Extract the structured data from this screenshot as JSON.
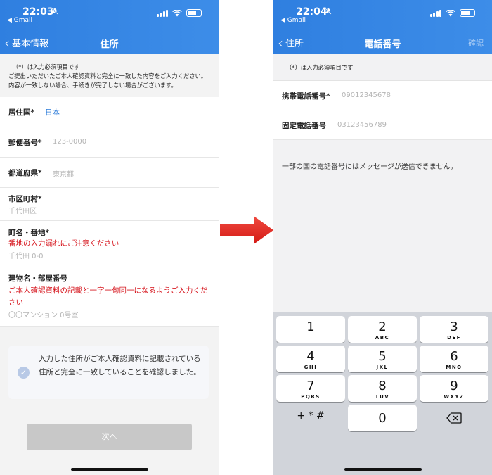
{
  "left": {
    "status": {
      "time": "22:03",
      "back_app": "◀ Gmail"
    },
    "nav": {
      "back_label": "基本情報",
      "title": "住所"
    },
    "notice": {
      "line1": "（*）は入力必須項目です",
      "line2": "ご提出いただいたご本人確認資料と完全に一致した内容をご入力ください。内容が一致しない場合、手続きが完了しない場合がございます。"
    },
    "fields": {
      "country": {
        "label": "居住国*",
        "value": "日本"
      },
      "postal": {
        "label": "郵便番号*",
        "placeholder": "123-0000"
      },
      "prefecture": {
        "label": "都道府県*",
        "placeholder": "東京都"
      },
      "city": {
        "label": "市区町村*",
        "placeholder": "千代田区"
      },
      "street": {
        "label": "町名・番地*",
        "warning": "番地の入力漏れにご注意ください",
        "placeholder": "千代田 0-0"
      },
      "building": {
        "label": "建物名・部屋番号",
        "warning": "ご本人確認資料の記載と一字一句同一になるようご入力ください",
        "placeholder": "〇〇マンション 0号室"
      }
    },
    "confirm_text": "入力した住所がご本人確認資料に記載されている住所と完全に一致していることを確認しました。",
    "next_button": "次へ"
  },
  "right": {
    "status": {
      "time": "22:04",
      "back_app": "◀ Gmail"
    },
    "nav": {
      "back_label": "住所",
      "title": "電話番号",
      "confirm": "確認"
    },
    "notice": "（*）は入力必須項目です",
    "fields": {
      "mobile": {
        "label": "携帯電話番号*",
        "placeholder": "09012345678"
      },
      "landline": {
        "label": "固定電話番号",
        "placeholder": "03123456789"
      }
    },
    "info": "一部の国の電話番号にはメッセージが送信できません。",
    "keypad": [
      {
        "digit": "1",
        "letters": ""
      },
      {
        "digit": "2",
        "letters": "ABC"
      },
      {
        "digit": "3",
        "letters": "DEF"
      },
      {
        "digit": "4",
        "letters": "GHI"
      },
      {
        "digit": "5",
        "letters": "JKL"
      },
      {
        "digit": "6",
        "letters": "MNO"
      },
      {
        "digit": "7",
        "letters": "PQRS"
      },
      {
        "digit": "8",
        "letters": "TUV"
      },
      {
        "digit": "9",
        "letters": "WXYZ"
      },
      {
        "digit": "+ * #",
        "letters": ""
      },
      {
        "digit": "0",
        "letters": ""
      },
      {
        "digit": "⌫",
        "letters": ""
      }
    ]
  },
  "icons": [
    "bell-slash-icon",
    "signal-icon",
    "wifi-icon",
    "battery-icon",
    "chevron-left-icon",
    "check-circle-icon",
    "red-arrow-icon",
    "backspace-icon"
  ],
  "colors": {
    "header": "#2f7fe0",
    "link": "#2a7ad8",
    "warning": "#d6151d",
    "arrow": "#e32620"
  }
}
